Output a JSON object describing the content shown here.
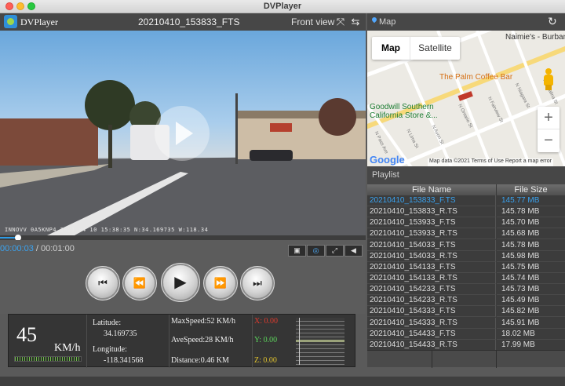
{
  "window": {
    "title": "DVPlayer"
  },
  "player": {
    "app_name": "DVPlayer",
    "file_title": "20210410_153833_FTS",
    "view_label": "Front view",
    "osd_text": "INNOVV 0A5KNP4 2021 04 10 15:38:35 N:34.169735 W:118.34",
    "current_time": "00:00:03",
    "separator": " / ",
    "total_time": "00:01:00",
    "progress_fraction": 0.05
  },
  "icons": {
    "fullscreen": "expand-arrows-icon",
    "swap": "swap-arrows-icon",
    "snapshot": "image-icon",
    "target": "target-icon",
    "window": "window-icon",
    "volume": "speaker-icon",
    "refresh": "refresh-icon",
    "pin": "map-pin-icon"
  },
  "playback": {
    "previous_symbol": "⏮",
    "rewind_symbol": "⏪",
    "play_symbol": "▶",
    "forward_symbol": "⏩",
    "next_symbol": "⏭"
  },
  "telemetry": {
    "speed": "45",
    "speed_unit": "KM/h",
    "latitude_label": "Latitude:",
    "latitude": "34.169735",
    "longitude_label": "Longitude:",
    "longitude": "-118.341568",
    "max_speed": "MaxSpeed:52 KM/h",
    "ave_speed": "AveSpeed:28 KM/h",
    "distance": "Distance:0.46 KM",
    "x": "X: 0.00",
    "y": "Y: 0.00",
    "z": "Z: 0.00"
  },
  "map": {
    "title": "Map",
    "tab_map": "Map",
    "tab_satellite": "Satellite",
    "zoom_in": "+",
    "zoom_out": "−",
    "google": "Google",
    "attribution": "Map data ©2021   Terms of Use   Report a map error",
    "places": {
      "naimie": "Naimie's - Burbank",
      "palm": "The Palm Coffee Bar",
      "goodwill_1": "Goodwill Southern",
      "goodwill_2": "California Store &..."
    },
    "streets": {
      "fairview": "N Fairview St",
      "ontario": "N Ontario St",
      "niagara": "N Niagara St",
      "lima": "N Lima St",
      "avon": "N Avon St",
      "pass": "N Pass Ave",
      "catalina": "N Catalina St"
    },
    "colors": {
      "road": "#ffffff",
      "major_road": "#f7d97a",
      "place_orange": "#d56e12",
      "place_green": "#1e7e34"
    }
  },
  "playlist": {
    "title": "Playlist",
    "col_name": "File Name",
    "col_size": "File Size",
    "rows": [
      {
        "name": "20210410_153833_F.TS",
        "size": "145.77 MB"
      },
      {
        "name": "20210410_153833_R.TS",
        "size": "145.78 MB"
      },
      {
        "name": "20210410_153933_F.TS",
        "size": "145.70 MB"
      },
      {
        "name": "20210410_153933_R.TS",
        "size": "145.68 MB"
      },
      {
        "name": "20210410_154033_F.TS",
        "size": "145.78 MB"
      },
      {
        "name": "20210410_154033_R.TS",
        "size": "145.98 MB"
      },
      {
        "name": "20210410_154133_F.TS",
        "size": "145.75 MB"
      },
      {
        "name": "20210410_154133_R.TS",
        "size": "145.74 MB"
      },
      {
        "name": "20210410_154233_F.TS",
        "size": "145.73 MB"
      },
      {
        "name": "20210410_154233_R.TS",
        "size": "145.49 MB"
      },
      {
        "name": "20210410_154333_F.TS",
        "size": "145.82 MB"
      },
      {
        "name": "20210410_154333_R.TS",
        "size": "145.91 MB"
      },
      {
        "name": "20210410_154433_F.TS",
        "size": "18.02 MB"
      },
      {
        "name": "20210410_154433_R.TS",
        "size": "17.99 MB"
      }
    ]
  }
}
